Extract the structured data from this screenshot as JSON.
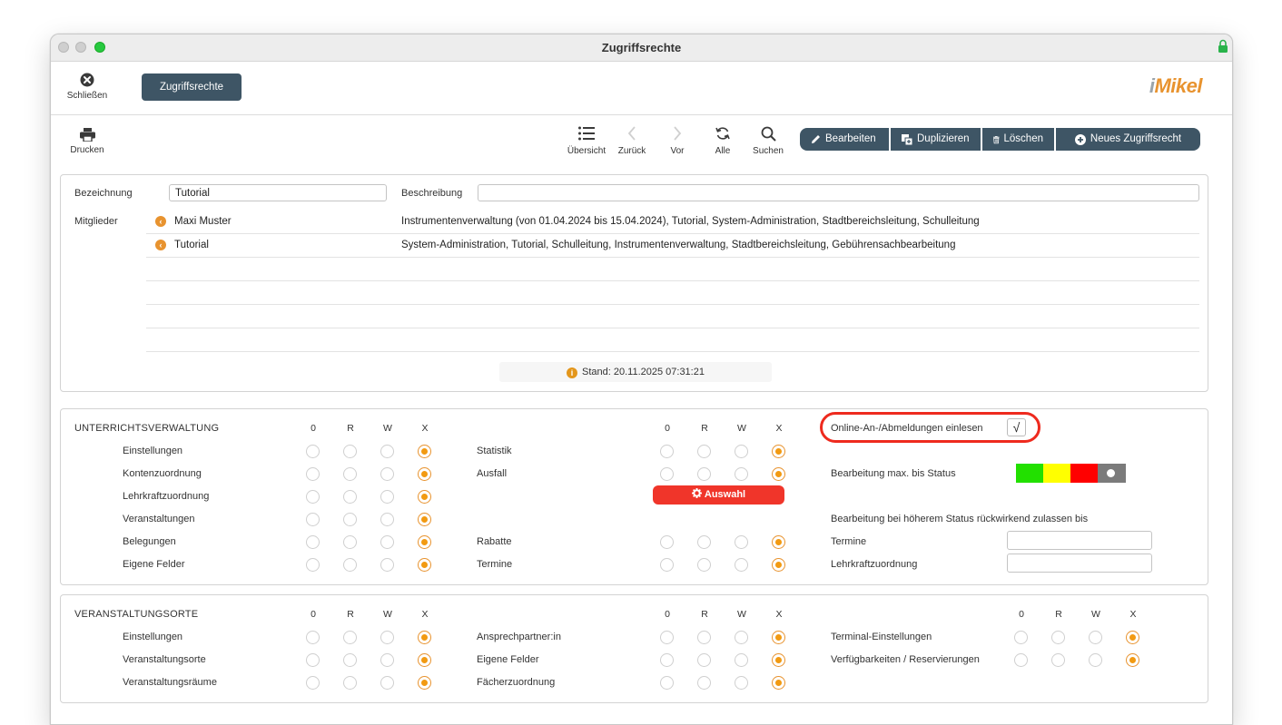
{
  "window": {
    "title": "Zugriffsrechte"
  },
  "topbar": {
    "close_label": "Schließen",
    "tab_label": "Zugriffsrechte",
    "logo_text_i": "i",
    "logo_text": "Mikel"
  },
  "toolbar": {
    "print_label": "Drucken",
    "overview_label": "Übersicht",
    "back_label": "Zurück",
    "forward_label": "Vor",
    "all_label": "Alle",
    "search_label": "Suchen",
    "actions": [
      {
        "label": "Bearbeiten",
        "icon": "pencil-icon"
      },
      {
        "label": "Duplizieren",
        "icon": "duplicate-icon"
      },
      {
        "label": "Löschen",
        "icon": "trash-icon"
      },
      {
        "label": "Neues Zugriffsrecht",
        "icon": "plus-circle-icon"
      }
    ]
  },
  "form": {
    "bezeichnung_label": "Bezeichnung",
    "bezeichnung_value": "Tutorial",
    "beschreibung_label": "Beschreibung",
    "beschreibung_value": "",
    "mitglieder_label": "Mitglieder",
    "members": [
      {
        "name": "Maxi Muster",
        "groups": "Instrumentenverwaltung (von 01.04.2024 bis 15.04.2024), Tutorial, System-Administration, Stadtbereichsleitung, Schulleitung"
      },
      {
        "name": "Tutorial",
        "groups": "System-Administration, Tutorial, Schulleitung, Instrumentenverwaltung, Stadtbereichsleitung, Gebührensachbearbeitung"
      }
    ],
    "stand_text": "Stand: 20.11.2025 07:31:21"
  },
  "rights_headers": [
    "0",
    "R",
    "W",
    "X"
  ],
  "unterricht": {
    "title": "UNTERRICHTSVERWALTUNG",
    "left_rows": [
      {
        "label": "Einstellungen",
        "value": "X"
      },
      {
        "label": "Kontenzuordnung",
        "value": "X"
      },
      {
        "label": "Lehrkraftzuordnung",
        "value": "X"
      },
      {
        "label": "Veranstaltungen",
        "value": "X"
      },
      {
        "label": "Belegungen",
        "value": "X"
      },
      {
        "label": "Eigene Felder",
        "value": "X"
      }
    ],
    "mid_rows": [
      {
        "label": "Statistik",
        "value": "X"
      },
      {
        "label": "Ausfall",
        "value": "X"
      },
      {
        "label": "Rabatte",
        "value": "X"
      },
      {
        "label": "Termine",
        "value": "X"
      }
    ],
    "auswahl_label": "Auswahl",
    "online_label": "Online-An-/Abmeldungen einlesen",
    "online_checked": "√",
    "status_label": "Bearbeitung max. bis Status",
    "status_colors": [
      "#22e000",
      "#ffff00",
      "#ff0000",
      "#7b7b7b"
    ],
    "retro_label": "Bearbeitung bei höherem Status rückwirkend zulassen bis",
    "termine_label": "Termine",
    "lehrkraft_label": "Lehrkraftzuordnung"
  },
  "orte": {
    "title": "VERANSTALTUNGSORTE",
    "left_rows": [
      {
        "label": "Einstellungen",
        "value": "X"
      },
      {
        "label": "Veranstaltungsorte",
        "value": "X"
      },
      {
        "label": "Veranstaltungsräume",
        "value": "X"
      }
    ],
    "mid_rows": [
      {
        "label": "Ansprechpartner:in",
        "value": "X"
      },
      {
        "label": "Eigene Felder",
        "value": "X"
      },
      {
        "label": "Fächerzuordnung",
        "value": "X"
      }
    ],
    "right_rows": [
      {
        "label": "Terminal-Einstellungen",
        "value": "X"
      },
      {
        "label": "Verfügbarkeiten / Reservierungen",
        "value": "X"
      }
    ]
  }
}
